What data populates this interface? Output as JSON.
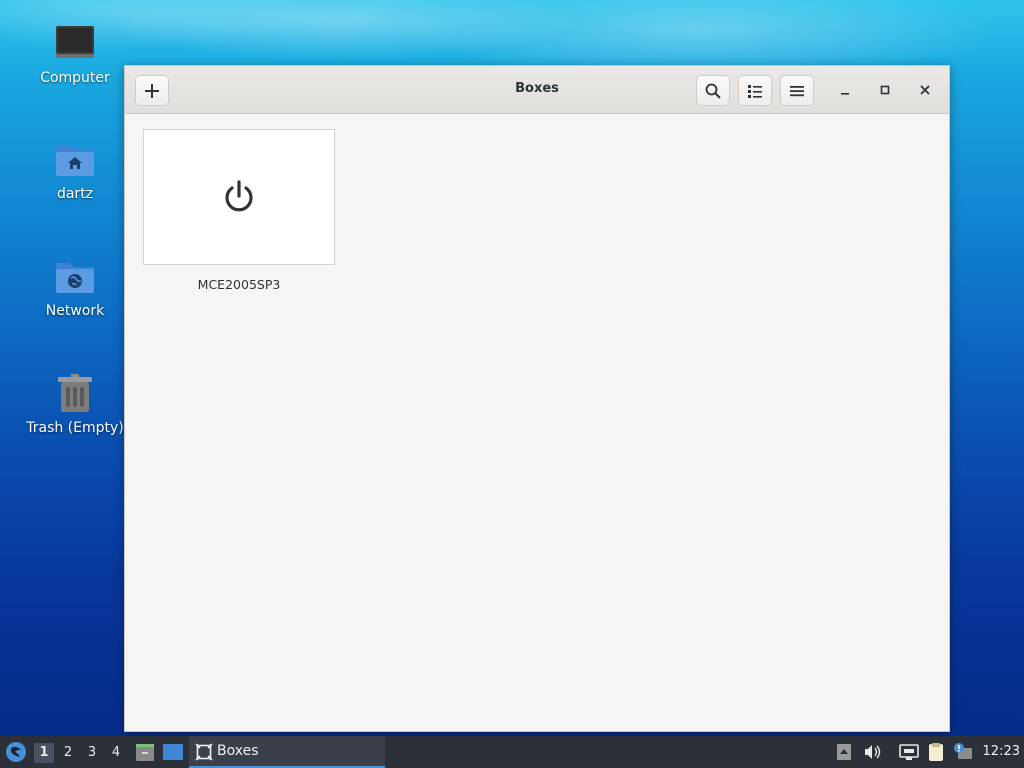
{
  "desktop": {
    "icons": [
      {
        "label": "Computer"
      },
      {
        "label": "dartz"
      },
      {
        "label": "Network"
      },
      {
        "label": "Trash (Empty)"
      }
    ]
  },
  "window": {
    "title": "Boxes",
    "boxes": [
      {
        "name": "MCE2005SP3",
        "state": "powered-off",
        "icon": "power-icon"
      }
    ]
  },
  "taskbar": {
    "workspaces": [
      "1",
      "2",
      "3",
      "4"
    ],
    "active_workspace": "1",
    "task_label": "Boxes",
    "clock": "12:23"
  },
  "colors": {
    "accent": "#4a90d9",
    "taskbar_bg": "#2c3038"
  }
}
